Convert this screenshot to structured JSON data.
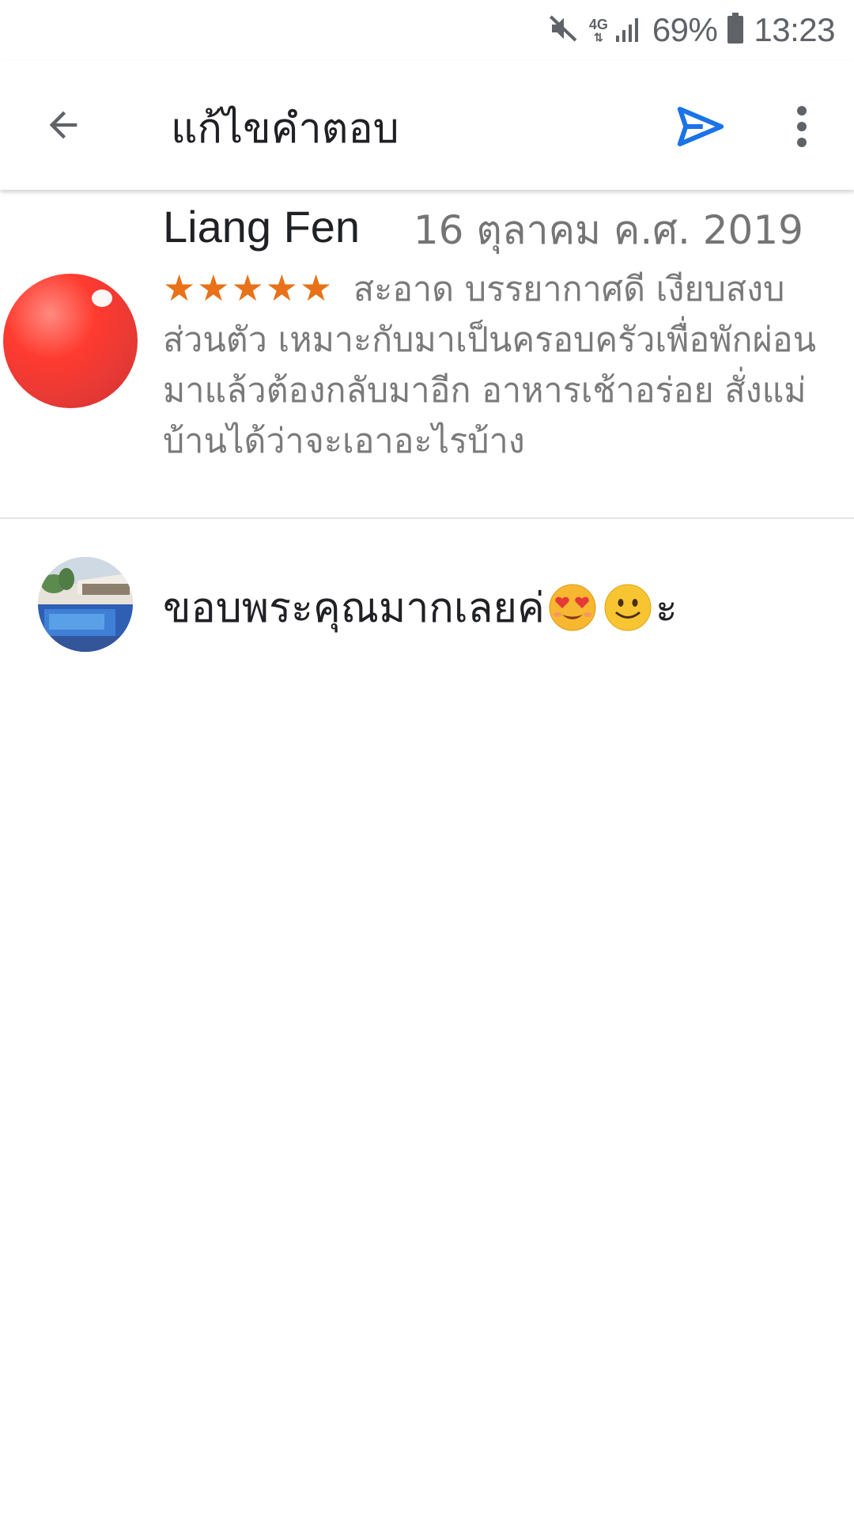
{
  "status_bar": {
    "network_type": "4G",
    "network_arrows": "⇅",
    "battery_percent": "69%",
    "time": "13:23",
    "icons": [
      "mute-icon",
      "signal-icon",
      "battery-icon"
    ]
  },
  "app_bar": {
    "title": "แก้ไขคำตอบ",
    "icons": [
      "back-arrow-icon",
      "send-icon",
      "more-vertical-icon"
    ],
    "send_color": "#1a73e8"
  },
  "review": {
    "reviewer_name": "Liang Fen",
    "date": "16 ตุลาคม ค.ศ. 2019",
    "rating": 5,
    "stars": [
      "★",
      "★",
      "★",
      "★",
      "★"
    ],
    "star_color": "#e8711a",
    "text": "สะอาด บรรยากาศดี เงียบสงบ ส่วนตัว เหมาะกับมาเป็นครอบครัวเพื่อพักผ่อน มาแล้วต้องกลับมาอีก อาหารเช้าอร่อย สั่งแม่บ้านได้ว่าจะเอาอะไรบ้าง"
  },
  "reply": {
    "text_before": "ขอบพระคุณมากเลยค่",
    "emoji_1": "heart-eyes-emoji",
    "emoji_2": "smiling-face-emoji",
    "text_after": "ะ"
  }
}
